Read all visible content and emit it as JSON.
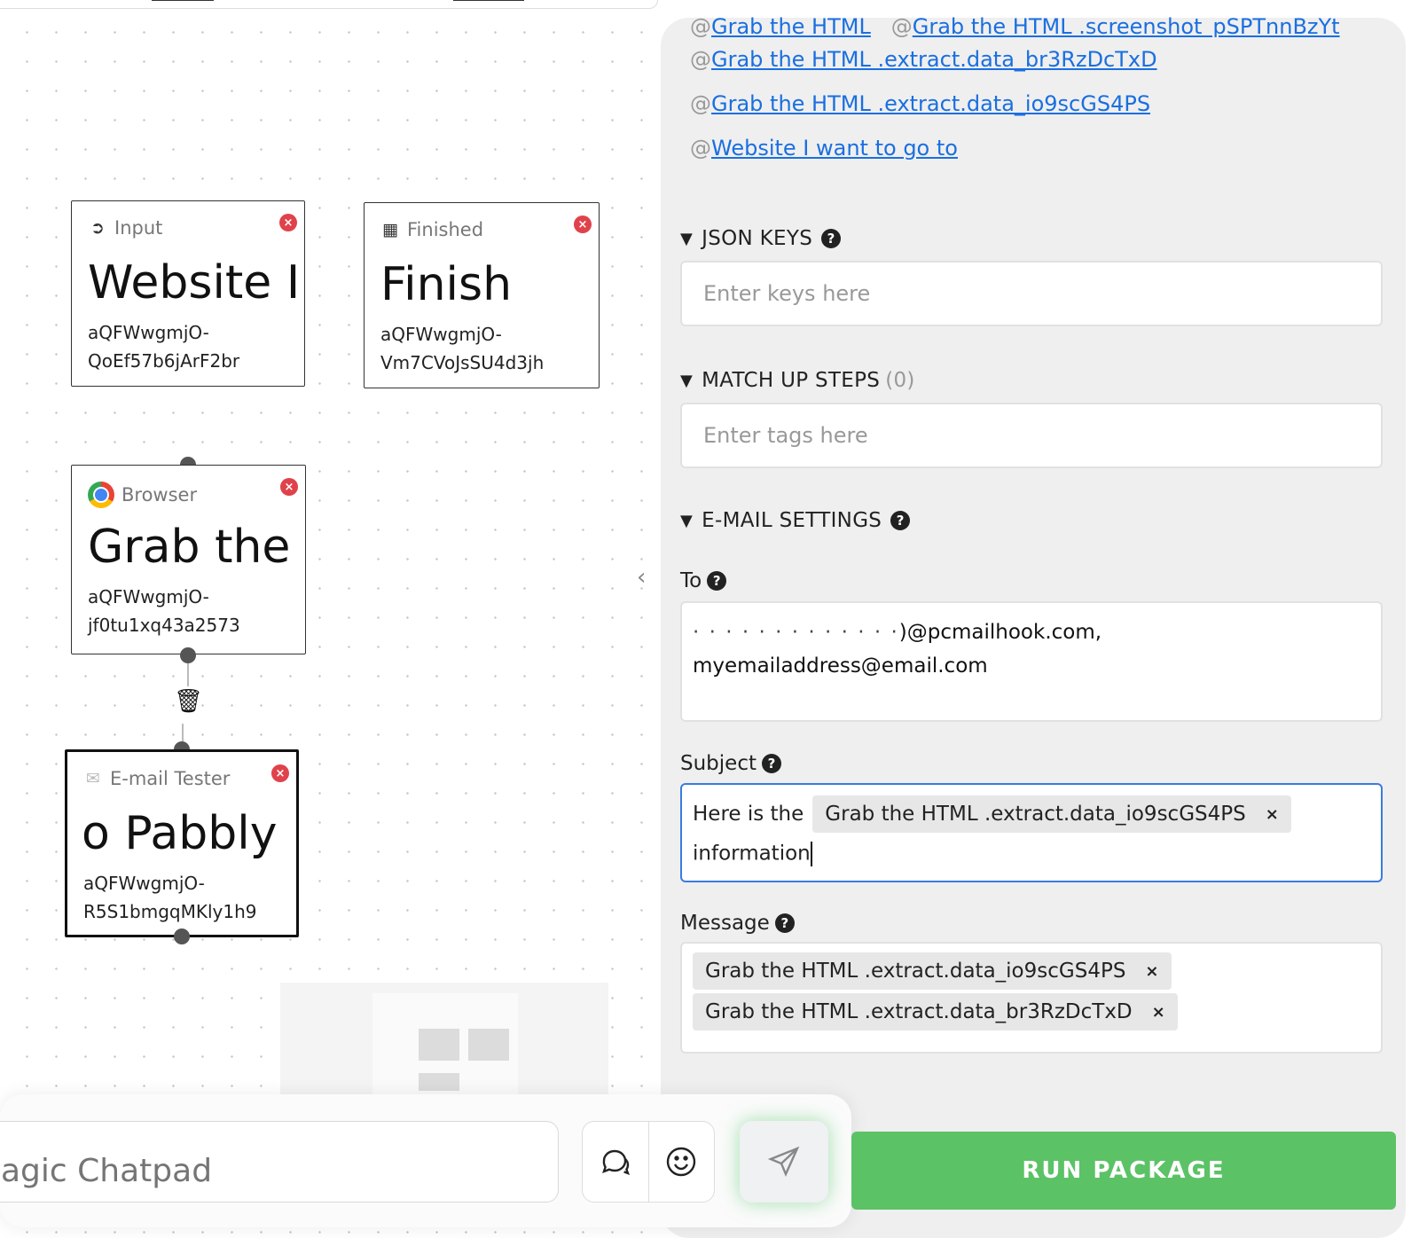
{
  "canvas": {
    "nodes": {
      "input": {
        "type": "Input",
        "title": "Website I",
        "id": "aQFWwgmjO-QoEf57b6jArF2br"
      },
      "finished": {
        "type": "Finished",
        "title": "Finish",
        "id": "aQFWwgmjO-Vm7CVoJsSU4d3jh"
      },
      "browser": {
        "type": "Browser",
        "title": "Grab the",
        "id": "aQFWwgmjO-jf0tu1xq43a2573"
      },
      "email": {
        "type": "E-mail Tester",
        "title": "o Pabbly",
        "id": "aQFWwgmjO-R5S1bmgqMKly1h9"
      }
    }
  },
  "chat": {
    "placeholder": "agic Chatpad"
  },
  "panel": {
    "refs": [
      {
        "prefix": "@",
        "label": "Grab the HTML",
        "label2": "Grab the HTML .screenshot_pSPTnnBzYt"
      },
      {
        "prefix": "@",
        "label": "Grab the HTML .extract.data_br3RzDcTxD"
      },
      {
        "prefix": "@",
        "label": "Grab the HTML .extract.data_io9scGS4PS"
      },
      {
        "prefix": "@",
        "label": "Website I want to go to"
      }
    ],
    "json_keys": {
      "title": "JSON KEYS",
      "placeholder": "Enter keys here"
    },
    "match_up": {
      "title": "MATCH UP STEPS",
      "count": "(0)",
      "placeholder": "Enter tags here"
    },
    "email_settings": {
      "title": "E-MAIL SETTINGS",
      "to_label": "To",
      "to_value_line1_masked": "· · · · · · · · · · · · ·",
      "to_value_line1": ")@pcmailhook.com,",
      "to_value_line2": "myemailaddress@email.com",
      "subject_label": "Subject",
      "subject_prefix": "Here is the",
      "subject_tag": "Grab the HTML .extract.data_io9scGS4PS",
      "subject_suffix": "information",
      "message_label": "Message",
      "message_tags": [
        "Grab the HTML .extract.data_io9scGS4PS",
        "Grab the HTML .extract.data_br3RzDcTxD"
      ]
    },
    "run_button": "RUN PACKAGE"
  },
  "colors": {
    "accent": "#5cc266",
    "link": "#1a6fe0",
    "close": "#e0424b",
    "focus": "#3b7be0"
  }
}
